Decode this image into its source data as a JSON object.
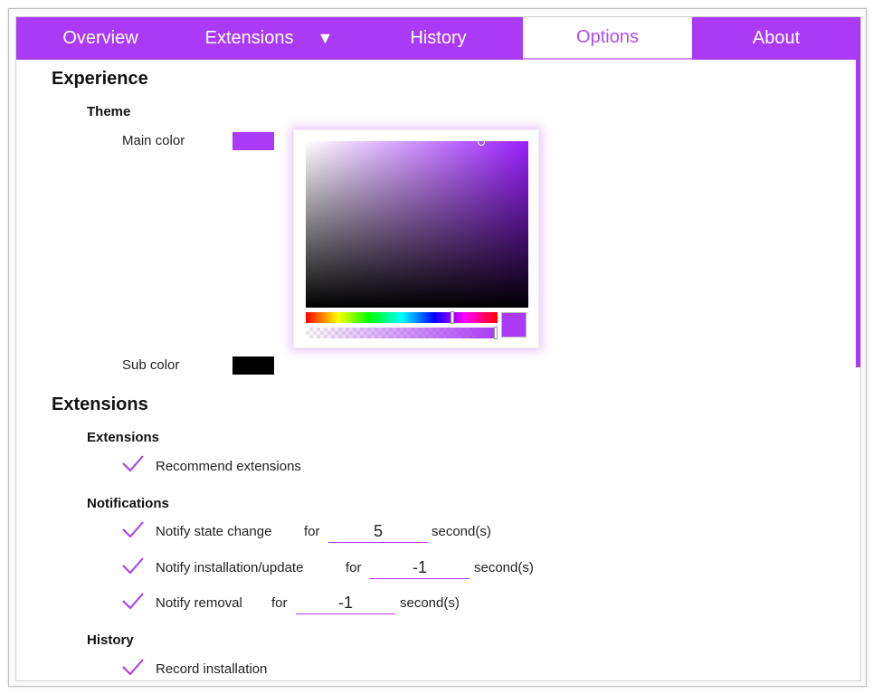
{
  "tabs": [
    {
      "label": "Overview"
    },
    {
      "label": "Extensions",
      "caret": "▼"
    },
    {
      "label": "History"
    },
    {
      "label": "Options"
    },
    {
      "label": "About"
    }
  ],
  "experience": {
    "heading": "Experience",
    "theme": {
      "heading": "Theme",
      "main_color_label": "Main color",
      "main_color": "#aa3af5",
      "sub_color_label": "Sub color",
      "sub_color": "#000000"
    },
    "picker": {
      "hue_level": 0.77,
      "alpha_level": 1.0
    }
  },
  "extensions": {
    "heading": "Extensions",
    "extensions_group": {
      "heading": "Extensions",
      "recommend_label": "Recommend extensions"
    },
    "notifications": {
      "heading": "Notifications",
      "state_change": {
        "label": "Notify state change",
        "for_label": "for",
        "value": "5",
        "unit": "second(s)"
      },
      "install_update": {
        "label": "Notify installation/update",
        "for_label": "for",
        "value": "-1",
        "unit": "second(s)"
      },
      "removal": {
        "label": "Notify removal",
        "for_label": "for",
        "value": "-1",
        "unit": "second(s)"
      }
    },
    "history": {
      "heading": "History",
      "record_install_label": "Record installation"
    }
  },
  "colors": {
    "accent": "#aa3af5"
  },
  "icons": {
    "check": "check-icon",
    "caret": "caret-down-icon"
  }
}
